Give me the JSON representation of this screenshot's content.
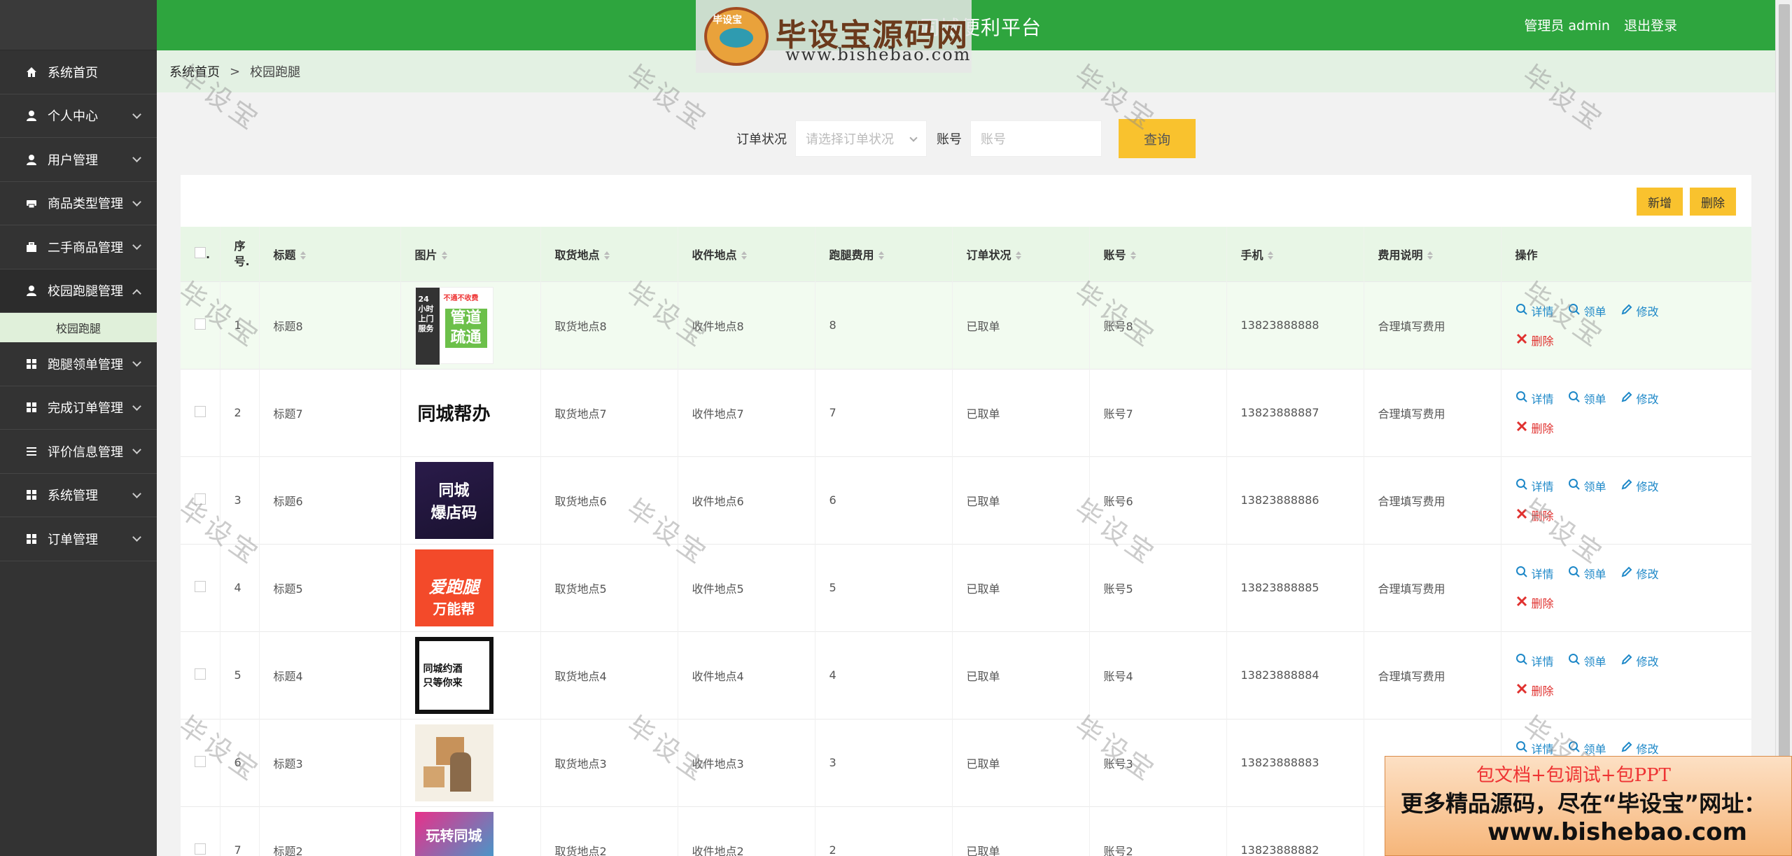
{
  "header": {
    "title": "同城便利平台",
    "user_label": "管理员 admin",
    "logout": "退出登录"
  },
  "logo": {
    "text": "毕设宝源码网",
    "url": "www.bishebao.com",
    "badge": "毕设宝"
  },
  "sidebar": {
    "items": [
      {
        "label": "系统首页",
        "icon": "home-icon"
      },
      {
        "label": "个人中心",
        "icon": "user-icon"
      },
      {
        "label": "用户管理",
        "icon": "user-icon"
      },
      {
        "label": "商品类型管理",
        "icon": "printer-icon"
      },
      {
        "label": "二手商品管理",
        "icon": "briefcase-icon"
      },
      {
        "label": "校园跑腿管理",
        "icon": "user-icon",
        "expanded": true,
        "sub": [
          "校园跑腿"
        ]
      },
      {
        "label": "跑腿领单管理",
        "icon": "grid-icon"
      },
      {
        "label": "完成订单管理",
        "icon": "grid-icon"
      },
      {
        "label": "评价信息管理",
        "icon": "list-icon"
      },
      {
        "label": "系统管理",
        "icon": "grid-icon"
      },
      {
        "label": "订单管理",
        "icon": "grid-icon"
      }
    ]
  },
  "breadcrumb": {
    "home": "系统首页",
    "sep": ">",
    "current": "校园跑腿"
  },
  "search": {
    "status_label": "订单状况",
    "status_placeholder": "请选择订单状况",
    "account_label": "账号",
    "account_placeholder": "账号",
    "query_button": "查询"
  },
  "toolbar": {
    "add": "新增",
    "delete": "删除"
  },
  "table": {
    "headers": [
      "序号.",
      "标题",
      "图片",
      "取货地点",
      "收件地点",
      "跑腿费用",
      "订单状况",
      "账号",
      "手机",
      "费用说明",
      "操作"
    ],
    "header_first": ".",
    "ops": {
      "detail": "详情",
      "take": "领单",
      "edit": "修改",
      "del": "删除"
    },
    "rows": [
      {
        "no": "1",
        "title": "标题8",
        "pickup": "取货地点8",
        "dest": "收件地点8",
        "fee": "8",
        "status": "已取单",
        "account": "账号8",
        "phone": "13823888888",
        "note": "合理填写费用",
        "img": "pipe"
      },
      {
        "no": "2",
        "title": "标题7",
        "pickup": "取货地点7",
        "dest": "收件地点7",
        "fee": "7",
        "status": "已取单",
        "account": "账号7",
        "phone": "13823888887",
        "note": "合理填写费用",
        "img": "help"
      },
      {
        "no": "3",
        "title": "标题6",
        "pickup": "取货地点6",
        "dest": "收件地点6",
        "fee": "6",
        "status": "已取单",
        "account": "账号6",
        "phone": "13823888886",
        "note": "合理填写费用",
        "img": "shop"
      },
      {
        "no": "4",
        "title": "标题5",
        "pickup": "取货地点5",
        "dest": "收件地点5",
        "fee": "5",
        "status": "已取单",
        "account": "账号5",
        "phone": "13823888885",
        "note": "合理填写费用",
        "img": "run"
      },
      {
        "no": "5",
        "title": "标题4",
        "pickup": "取货地点4",
        "dest": "收件地点4",
        "fee": "4",
        "status": "已取单",
        "account": "账号4",
        "phone": "13823888884",
        "note": "合理填写费用",
        "img": "wine"
      },
      {
        "no": "6",
        "title": "标题3",
        "pickup": "取货地点3",
        "dest": "收件地点3",
        "fee": "3",
        "status": "已取单",
        "account": "账号3",
        "phone": "13823888883",
        "note": "",
        "img": "courier"
      },
      {
        "no": "7",
        "title": "标题2",
        "pickup": "取货地点2",
        "dest": "收件地点2",
        "fee": "2",
        "status": "已取单",
        "account": "账号2",
        "phone": "13823888882",
        "note": "",
        "img": "fun"
      }
    ]
  },
  "images": {
    "pipe_top": "不通不收费",
    "pipe_main": "管道疏通",
    "pipe_side": "24小时上门服务",
    "help": "同城帮办",
    "shop_1": "同城",
    "shop_2": "爆店码",
    "run_1": "爱跑腿",
    "run_2": "万能帮",
    "wine_1": "同城约酒",
    "wine_2": "只等你来",
    "fun": "玩转同城"
  },
  "watermark": "毕设宝",
  "promo": {
    "line1": "包文档+包调试+包PPT",
    "line2": "更多精品源码，尽在“毕设宝”网址：",
    "line3": "www.bishebao.com"
  },
  "colors": {
    "header": "#2ea53e",
    "sidebar": "#333333",
    "accent": "#f9c22e",
    "link": "#1e88c8",
    "danger": "#e0312f"
  }
}
